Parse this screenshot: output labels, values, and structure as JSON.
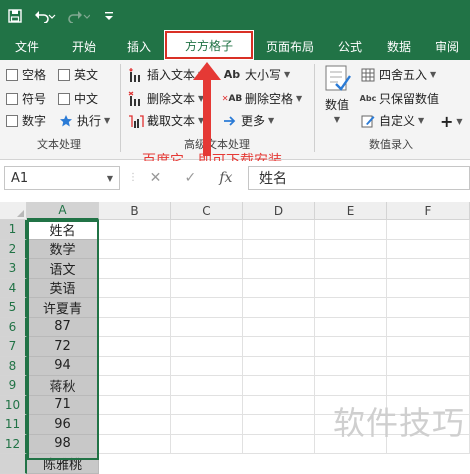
{
  "qat": {
    "icons": [
      "save-icon",
      "undo-icon",
      "redo-icon",
      "customize-icon"
    ]
  },
  "tabs": [
    {
      "label": "文件"
    },
    {
      "label": "开始"
    },
    {
      "label": "插入"
    },
    {
      "label": "方方格子",
      "active": true
    },
    {
      "label": "页面布局"
    },
    {
      "label": "公式"
    },
    {
      "label": "数据"
    },
    {
      "label": "审阅"
    }
  ],
  "ribbon": {
    "text_group": {
      "label": "文本处理",
      "options": [
        "空格",
        "英文",
        "符号",
        "中文",
        "数字"
      ],
      "execute": "执行"
    },
    "advanced_group": {
      "label": "高级文本处理",
      "insert_text": "插入文本",
      "delete_text": "删除文本",
      "cut_text": "截取文本",
      "case": "大小写",
      "delete_space": "删除空格",
      "more": "更多"
    },
    "number_group": {
      "label": "数值录入",
      "number_button": "数值",
      "round": "四舍五入",
      "keep_value": "只保留数值",
      "custom": "自定义"
    }
  },
  "annotation": {
    "text": "百度它，即可下载安装"
  },
  "formula_bar": {
    "name_box": "A1",
    "cancel": "✕",
    "confirm": "✓",
    "fx": "fx",
    "value": "姓名"
  },
  "sheet": {
    "columns": [
      "A",
      "B",
      "C",
      "D",
      "E",
      "F"
    ],
    "rows": [
      "1",
      "2",
      "3",
      "4",
      "5",
      "6",
      "7",
      "8",
      "9",
      "10",
      "11",
      "12"
    ],
    "column_a": [
      "姓名",
      "数学",
      "语文",
      "英语",
      "许夏青",
      "87",
      "72",
      "94",
      "蒋秋",
      "71",
      "96",
      "98"
    ],
    "partial_next": "陈雅桃"
  },
  "watermark": "软件技巧",
  "colors": {
    "excel_green": "#217346",
    "highlight_red": "#d93025"
  }
}
